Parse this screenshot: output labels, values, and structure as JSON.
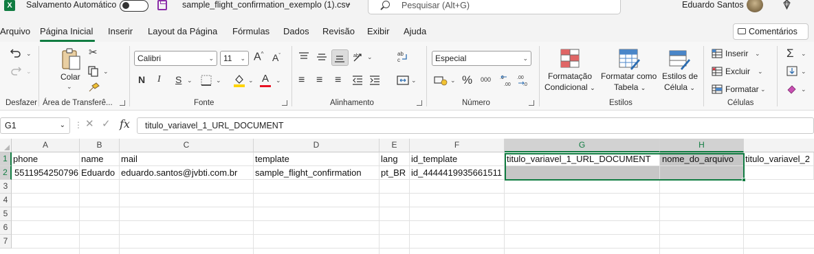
{
  "titlebar": {
    "app_logo": "X",
    "autosave_label": "Salvamento Automático",
    "filename": "sample_flight_confirmation_exemplo (1).csv",
    "search_placeholder": "Pesquisar (Alt+G)",
    "user_name": "Eduardo Santos",
    "icons": [
      "excel-logo-icon",
      "autosave-toggle",
      "save-icon",
      "search-icon",
      "avatar",
      "diamond-icon"
    ]
  },
  "menu": {
    "tabs": [
      "Arquivo",
      "Página Inicial",
      "Inserir",
      "Layout da Página",
      "Fórmulas",
      "Dados",
      "Revisão",
      "Exibir",
      "Ajuda"
    ],
    "active_tab": "Página Inicial",
    "comments_label": "Comentários"
  },
  "ribbon": {
    "groups": {
      "undo": "Desfazer",
      "clipboard": "Área de Transferê...",
      "font": "Fonte",
      "alignment": "Alinhamento",
      "number": "Número",
      "styles": "Estilos",
      "cells": "Células"
    },
    "clipboard": {
      "paste_label": "Colar"
    },
    "font": {
      "family": "Calibri",
      "size": "11",
      "bold": "N",
      "italic": "I",
      "underline": "S",
      "grow": "A",
      "shrink": "A",
      "font_color_letter": "A",
      "highlight_color": "#ffd400",
      "font_color": "#e81123"
    },
    "number": {
      "format": "Especial",
      "percent": "%",
      "thousands": "000"
    },
    "styles": {
      "conditional_line1": "Formatação",
      "conditional_line2": "Condicional",
      "as_table_line1": "Formatar como",
      "as_table_line2": "Tabela",
      "cell_styles_line1": "Estilos de",
      "cell_styles_line2": "Célula"
    },
    "cells": {
      "insert": "Inserir",
      "delete": "Excluir",
      "format": "Formatar"
    },
    "editing": {
      "sum": "Σ"
    },
    "alignment": {
      "wrap_icon": "ab↵"
    }
  },
  "formula_bar": {
    "name_box": "G1",
    "fx": "fx",
    "content": "titulo_variavel_1_URL_DOCUMENT"
  },
  "grid": {
    "columns": [
      "A",
      "B",
      "C",
      "D",
      "E",
      "F",
      "G",
      "H"
    ],
    "rows": [
      "1",
      "2",
      "3",
      "4",
      "5",
      "6",
      "7"
    ],
    "row1": [
      "phone",
      "name",
      "mail",
      "template",
      "lang",
      "id_template",
      "titulo_variavel_1_URL_DOCUMENT",
      "nome_do_arquivo",
      "titulo_variavel_2"
    ],
    "row2": [
      "5511954250796",
      "Eduardo",
      "eduardo.santos@jvbti.com.br",
      "sample_flight_confirmation",
      "pt_BR",
      "id_4444419935661511",
      "",
      ""
    ],
    "selection": "G1:H2",
    "accent": "#107c41"
  }
}
